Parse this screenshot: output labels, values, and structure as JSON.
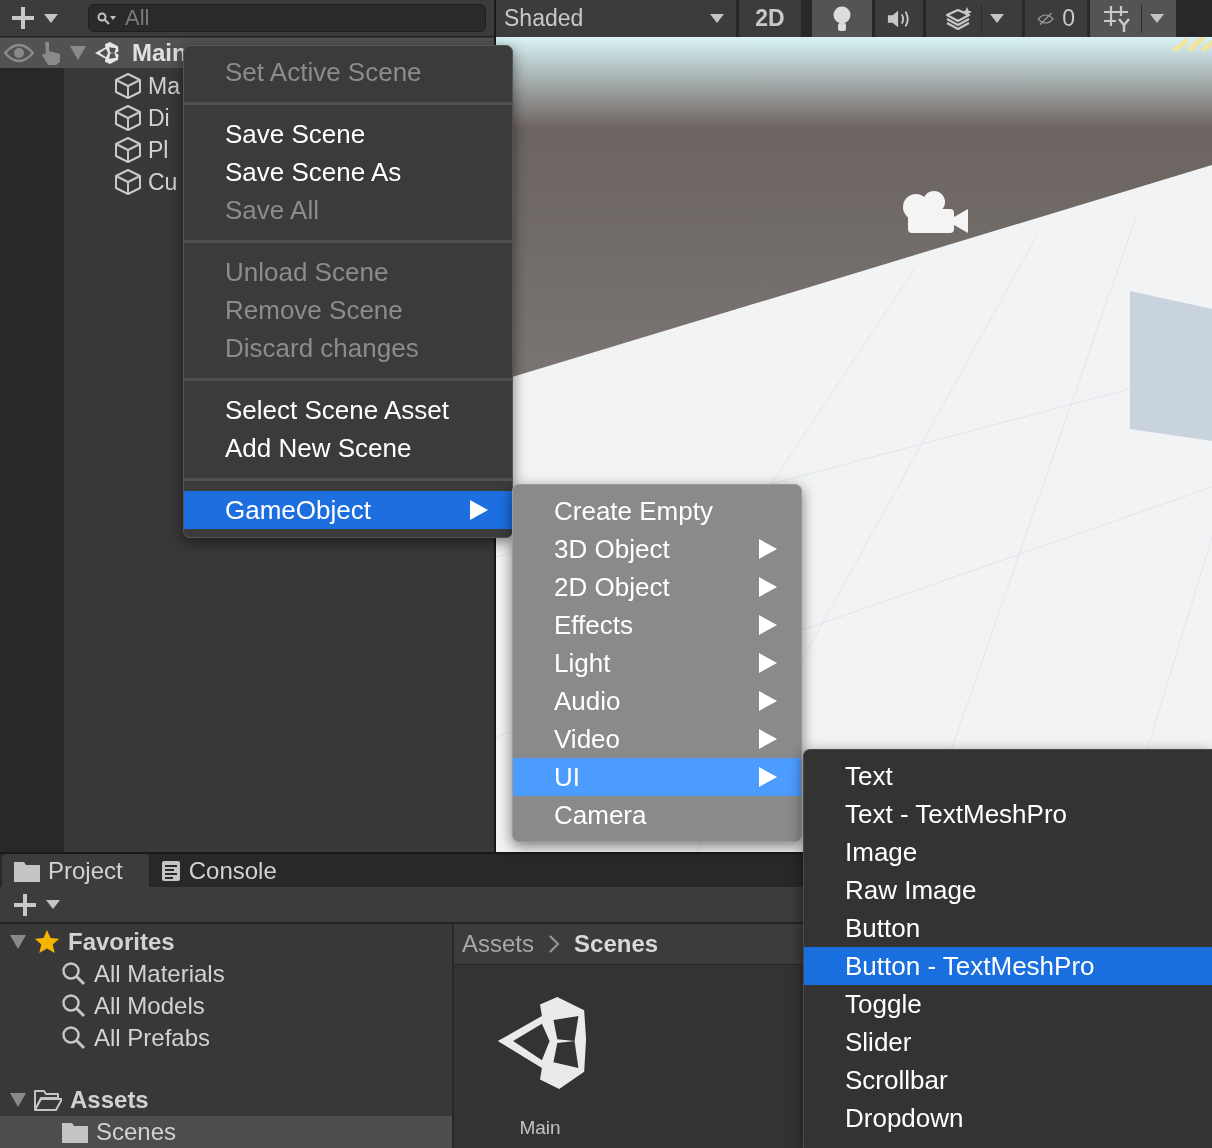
{
  "hierarchy": {
    "search": {
      "placeholder": "All"
    },
    "scene": {
      "name": "Main",
      "expanded": true
    },
    "objects": [
      "Ma",
      "Di",
      "Pl",
      "Cu"
    ]
  },
  "scene_view": {
    "shading": "Shaded",
    "mode_2d": {
      "label": "2D",
      "on": false
    },
    "lighting": {
      "on": true
    },
    "hidden_count": "0"
  },
  "context_menu": {
    "items": [
      {
        "kind": "item",
        "label": "Set Active Scene",
        "disabled": true,
        "selected": false
      },
      {
        "kind": "separator"
      },
      {
        "kind": "item",
        "label": "Save Scene",
        "disabled": false,
        "selected": false
      },
      {
        "kind": "item",
        "label": "Save Scene As",
        "disabled": false,
        "selected": false
      },
      {
        "kind": "item",
        "label": "Save All",
        "disabled": true,
        "selected": false
      },
      {
        "kind": "separator"
      },
      {
        "kind": "item",
        "label": "Unload Scene",
        "disabled": true,
        "selected": false
      },
      {
        "kind": "item",
        "label": "Remove Scene",
        "disabled": true,
        "selected": false
      },
      {
        "kind": "item",
        "label": "Discard changes",
        "disabled": true,
        "selected": false
      },
      {
        "kind": "separator"
      },
      {
        "kind": "item",
        "label": "Select Scene Asset",
        "disabled": false,
        "selected": false
      },
      {
        "kind": "item",
        "label": "Add New Scene",
        "disabled": false,
        "selected": false
      },
      {
        "kind": "separator"
      },
      {
        "kind": "item",
        "label": "GameObject",
        "disabled": false,
        "selected": true,
        "has_submenu": true
      }
    ]
  },
  "gameobject_menu": {
    "items": [
      {
        "kind": "item",
        "label": "Create Empty",
        "selected": false,
        "has_submenu": false
      },
      {
        "kind": "item",
        "label": "3D Object",
        "selected": false,
        "has_submenu": true
      },
      {
        "kind": "item",
        "label": "2D Object",
        "selected": false,
        "has_submenu": true
      },
      {
        "kind": "item",
        "label": "Effects",
        "selected": false,
        "has_submenu": true
      },
      {
        "kind": "item",
        "label": "Light",
        "selected": false,
        "has_submenu": true
      },
      {
        "kind": "item",
        "label": "Audio",
        "selected": false,
        "has_submenu": true
      },
      {
        "kind": "item",
        "label": "Video",
        "selected": false,
        "has_submenu": true
      },
      {
        "kind": "item",
        "label": "UI",
        "selected": true,
        "has_submenu": true
      },
      {
        "kind": "item",
        "label": "Camera",
        "selected": false,
        "has_submenu": false
      }
    ]
  },
  "ui_menu": {
    "items": [
      {
        "kind": "item",
        "label": "Text",
        "selected": false
      },
      {
        "kind": "item",
        "label": "Text - TextMeshPro",
        "selected": false
      },
      {
        "kind": "item",
        "label": "Image",
        "selected": false
      },
      {
        "kind": "item",
        "label": "Raw Image",
        "selected": false
      },
      {
        "kind": "item",
        "label": "Button",
        "selected": false
      },
      {
        "kind": "item",
        "label": "Button - TextMeshPro",
        "selected": true
      },
      {
        "kind": "item",
        "label": "Toggle",
        "selected": false
      },
      {
        "kind": "item",
        "label": "Slider",
        "selected": false
      },
      {
        "kind": "item",
        "label": "Scrollbar",
        "selected": false
      },
      {
        "kind": "item",
        "label": "Dropdown",
        "selected": false
      }
    ]
  },
  "project": {
    "tabs": [
      {
        "label": "Project",
        "selected": true
      },
      {
        "label": "Console",
        "selected": false
      }
    ],
    "favorites": {
      "label": "Favorites",
      "expanded": true,
      "children": [
        "All Materials",
        "All Models",
        "All Prefabs"
      ]
    },
    "assets": {
      "label": "Assets",
      "expanded": true,
      "children": [
        {
          "label": "Scenes",
          "selected": true
        }
      ]
    },
    "breadcrumb": [
      "Assets",
      "Scenes"
    ],
    "files": [
      {
        "name": "Main"
      }
    ]
  }
}
